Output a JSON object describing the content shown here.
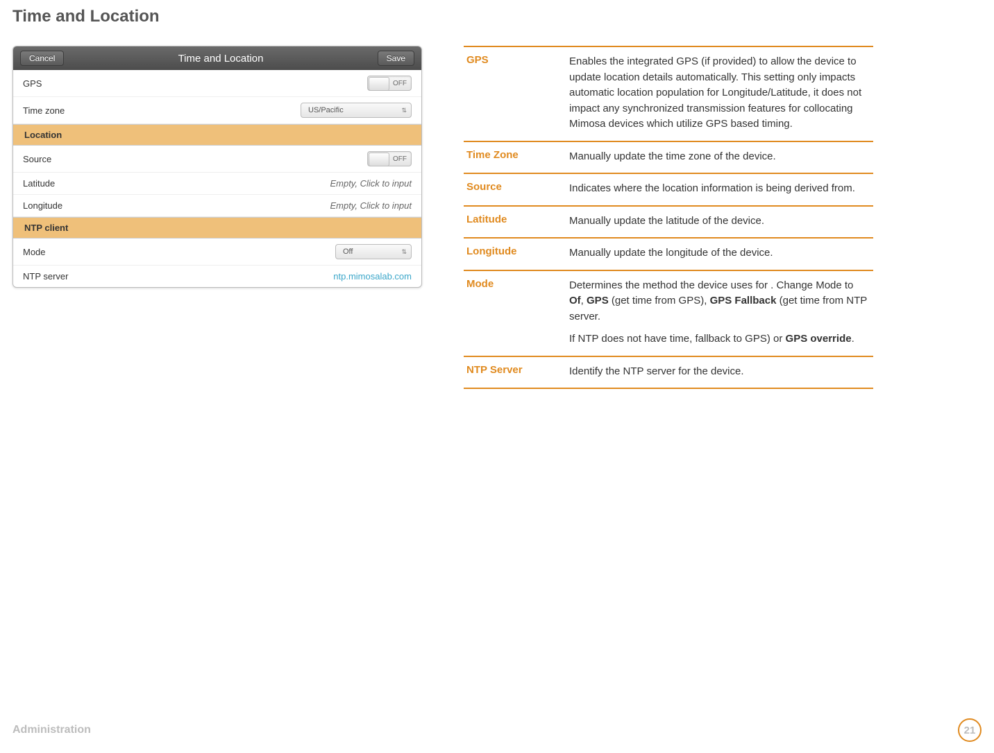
{
  "page": {
    "title": "Time and Location",
    "footer_label": "Administration",
    "page_number": "21"
  },
  "panel": {
    "header_title": "Time and Location",
    "cancel_label": "Cancel",
    "save_label": "Save",
    "rows_top": {
      "gps_label": "GPS",
      "gps_value": "OFF",
      "tz_label": "Time zone",
      "tz_value": "US/Pacific"
    },
    "section_location": "Location",
    "location_rows": {
      "source_label": "Source",
      "source_value": "OFF",
      "lat_label": "Latitude",
      "lat_value": "Empty, Click to input",
      "lon_label": "Longitude",
      "lon_value": "Empty, Click to input"
    },
    "section_ntp": "NTP client",
    "ntp_rows": {
      "mode_label": "Mode",
      "mode_value": "Off",
      "server_label": "NTP server",
      "server_value": "ntp.mimosalab.com"
    }
  },
  "definitions": [
    {
      "term": "GPS",
      "desc": "Enables the integrated GPS (if provided) to allow the device to update location details automatically. This setting only impacts automatic location population for Longitude/Latitude, it does not impact any synchronized transmission features for collocating Mimosa devices which utilize GPS based timing."
    },
    {
      "term": "Time Zone",
      "desc": "Manually update the time zone of the device."
    },
    {
      "term": "Source",
      "desc": "Indicates where the location information is being derived from."
    },
    {
      "term": "Latitude",
      "desc": "Manually update the latitude of the device."
    },
    {
      "term": "Longitude",
      "desc": "Manually update the longitude of the device."
    },
    {
      "term": "Mode",
      "desc_parts": {
        "p1_pre": "Determines the method the device uses for . Change Mode to ",
        "b1": "Of",
        "p1_mid1": ", ",
        "b2": "GPS",
        "p1_mid2": " (get time from GPS), ",
        "b3": "GPS Fallback",
        "p1_post": " (get time from NTP server.",
        "p2_pre": "If NTP does not have time, fallback to GPS) or ",
        "b4": "GPS override",
        "p2_post": "."
      }
    },
    {
      "term": "NTP Server",
      "desc": "Identify the NTP server for the device."
    }
  ]
}
